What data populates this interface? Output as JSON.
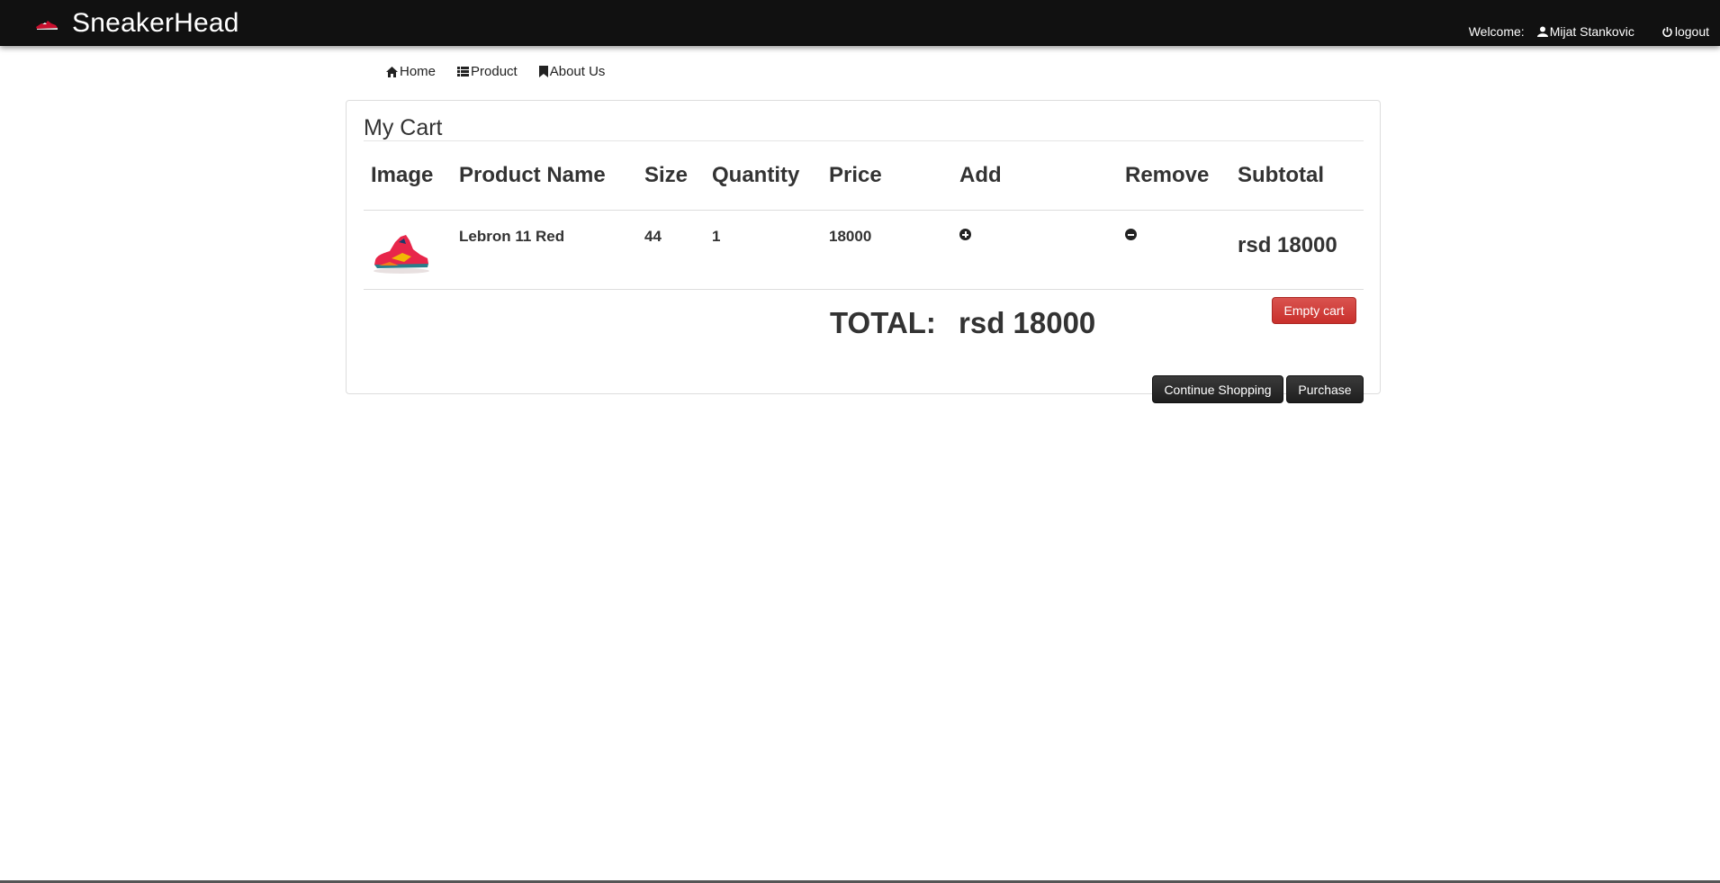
{
  "navbar": {
    "brand": "SneakerHead",
    "welcome_label": "Welcome:",
    "user_name": "Mijat Stankovic",
    "logout_label": "logout"
  },
  "subnav": {
    "home": "Home",
    "product": "Product",
    "about": "About Us"
  },
  "cart": {
    "title": "My Cart",
    "columns": [
      "Image",
      "Product Name",
      "Size",
      "Quantity",
      "Price",
      "Add",
      "Remove",
      "Subtotal"
    ],
    "items": [
      {
        "name": "Lebron 11 Red",
        "size": "44",
        "quantity": "1",
        "price": "18000",
        "subtotal": "rsd 18000"
      }
    ],
    "total_label": "TOTAL:",
    "total_value": "rsd 18000",
    "empty_cart_label": "Empty cart",
    "continue_label": "Continue Shopping",
    "purchase_label": "Purchase"
  },
  "colors": {
    "navbar_bg": "#111111",
    "danger": "#d9534f",
    "dark_button": "#222222"
  },
  "icons": {
    "home": "home-icon",
    "product": "list-icon",
    "about": "bookmark-icon",
    "user": "user-icon",
    "logout": "power-icon",
    "add": "plus-circle-icon",
    "remove": "minus-circle-icon"
  }
}
